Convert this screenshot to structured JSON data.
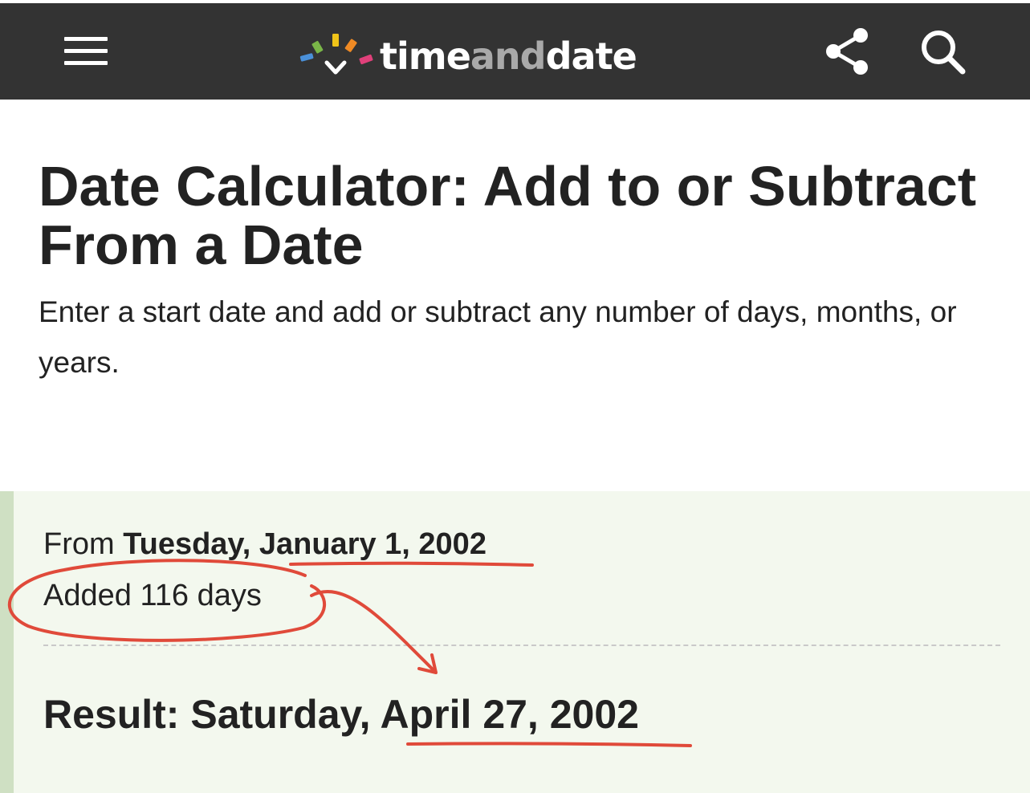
{
  "header": {
    "menu_icon": "hamburger-menu-icon",
    "logo": {
      "part1": "time",
      "part2": "and",
      "part3": "date",
      "colors": [
        "#4a90d9",
        "#7ab648",
        "#f0c419",
        "#f08a24",
        "#e0407a"
      ]
    },
    "share_icon": "share-icon",
    "search_icon": "search-icon",
    "background_color": "#333333"
  },
  "page": {
    "title": "Date Calculator: Add to or Subtract From a Date",
    "intro": "Enter a start date and add or subtract any number of days, months, or years."
  },
  "result": {
    "from_prefix": "From",
    "from_date": "Tuesday, January 1, 2002",
    "added": "Added 116 days",
    "result_text": "Result: Saturday, April 27, 2002",
    "background_color": "#f3f8ee",
    "accent_color": "#cfe0c3"
  },
  "annotations": {
    "color": "#e04a3a"
  }
}
